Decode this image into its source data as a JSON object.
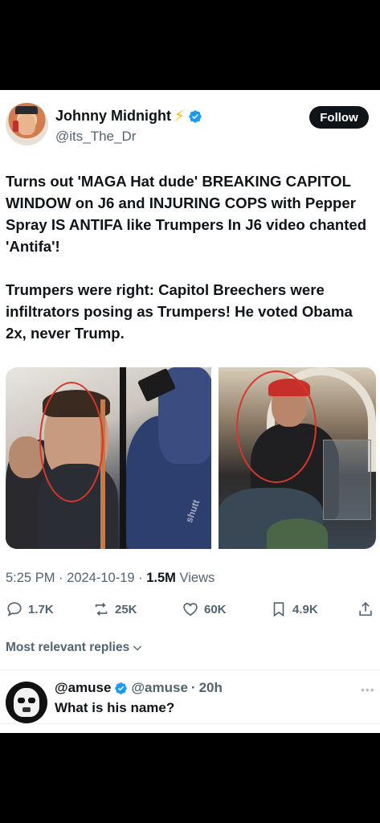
{
  "author": {
    "name": "Johnny Midnight",
    "emoji": "⚡",
    "handle": "@its_The_Dr",
    "follow_label": "Follow"
  },
  "tweet": {
    "text": "Turns out 'MAGA Hat dude' BREAKING CAPITOL WINDOW on J6 and INJURING COPS with Pepper Spray IS ANTIFA like Trumpers In J6 video chanted 'Antifa'!\n\nTrumpers were right: Capitol Breechers were infiltrators posing as Trumpers! He voted Obama 2x, never Trump.",
    "image_watermark": "shutt"
  },
  "meta": {
    "time": "5:25 PM",
    "date": "2024-10-19",
    "views_count": "1.5M",
    "views_label": "Views"
  },
  "actions": {
    "replies": "1.7K",
    "reposts": "25K",
    "likes": "60K",
    "bookmarks": "4.9K"
  },
  "replies_filter_label": "Most relevant replies",
  "reply": {
    "name": "@amuse",
    "handle": "@amuse",
    "time": "20h",
    "text": "What is his name?"
  },
  "colors": {
    "accent": "#1d9bf0",
    "text": "#0f1419",
    "muted": "#536471",
    "circle": "#d8372b"
  }
}
